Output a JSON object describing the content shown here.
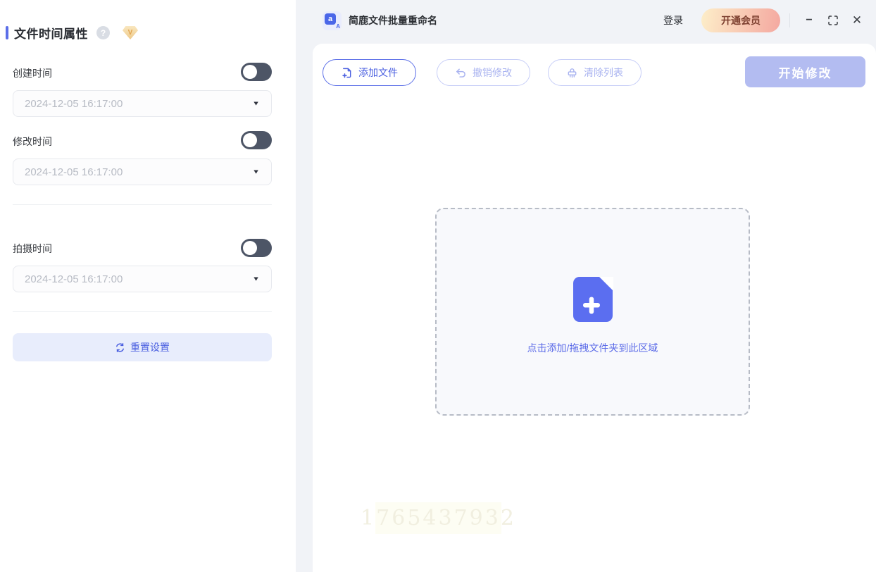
{
  "sidebar": {
    "title": "文件时间属性",
    "sections": [
      {
        "label": "创建时间",
        "value": "2024-12-05 16:17:00",
        "enabled": false
      },
      {
        "label": "修改时间",
        "value": "2024-12-05 16:17:00",
        "enabled": false
      },
      {
        "label": "拍摄时间",
        "value": "2024-12-05 16:17:00",
        "enabled": false
      }
    ],
    "reset_label": "重置设置"
  },
  "titlebar": {
    "app_title": "简鹿文件批量重命名",
    "app_icon_letter": "a",
    "login_label": "登录",
    "vip_button_label": "开通会员"
  },
  "window_controls": {
    "minimize": "−",
    "close": "✕"
  },
  "toolbar": {
    "add_files_label": "添加文件",
    "undo_label": "撤销修改",
    "clear_label": "清除列表",
    "start_label": "开始修改"
  },
  "dropzone": {
    "hint": "点击添加/拖拽文件夹到此区域"
  },
  "watermark": "1765437932",
  "icons": {
    "help": "?",
    "vip_gem": "V",
    "dropdown_caret": "▼"
  },
  "colors": {
    "accent": "#4a5fe0",
    "accent_border": "#5e71e8",
    "disabled_accent": "#a9b3f0",
    "start_button_bg": "#b3bcf1",
    "toggle_off_track": "#4d5566",
    "panel_bg": "#f1f3f7",
    "vip_gradient_start": "#fdeec9",
    "vip_gradient_end": "#f4a8a0",
    "vip_text": "#7d4030",
    "dropzone_icon": "#5b6ef0"
  }
}
